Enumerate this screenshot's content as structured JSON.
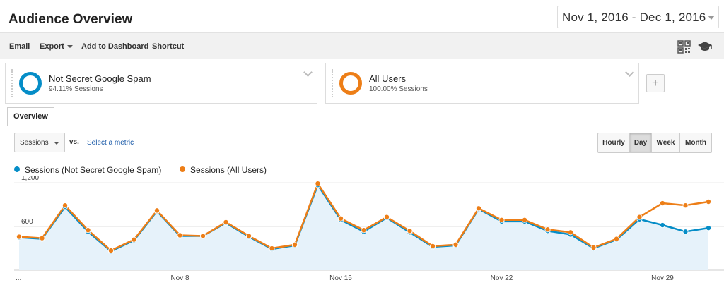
{
  "header": {
    "title": "Audience Overview",
    "date_range": "Nov 1, 2016 - Dec 1, 2016"
  },
  "toolbar": {
    "email": "Email",
    "export": "Export",
    "add_to_dashboard": "Add to Dashboard",
    "shortcut": "Shortcut"
  },
  "segments": [
    {
      "name": "Not Secret Google Spam",
      "sessions_pct": "94.11% Sessions",
      "color": "#058dc7"
    },
    {
      "name": "All Users",
      "sessions_pct": "100.00% Sessions",
      "color": "#ed7e17"
    }
  ],
  "tabs": {
    "overview": "Overview"
  },
  "controls": {
    "metric": "Sessions",
    "vs": "vs.",
    "select_metric": "Select a metric",
    "granularity": [
      "Hourly",
      "Day",
      "Week",
      "Month"
    ],
    "active_granularity": "Day"
  },
  "legend": [
    {
      "label": "Sessions (Not Secret Google Spam)",
      "color": "#058dc7"
    },
    {
      "label": "Sessions (All Users)",
      "color": "#ed7e17"
    }
  ],
  "chart_data": {
    "type": "line",
    "x_start": "...",
    "x": [
      "Nov 1",
      "Nov 2",
      "Nov 3",
      "Nov 4",
      "Nov 5",
      "Nov 6",
      "Nov 7",
      "Nov 8",
      "Nov 9",
      "Nov 10",
      "Nov 11",
      "Nov 12",
      "Nov 13",
      "Nov 14",
      "Nov 15",
      "Nov 16",
      "Nov 17",
      "Nov 18",
      "Nov 19",
      "Nov 20",
      "Nov 21",
      "Nov 22",
      "Nov 23",
      "Nov 24",
      "Nov 25",
      "Nov 26",
      "Nov 27",
      "Nov 28",
      "Nov 29",
      "Nov 30",
      "Dec 1"
    ],
    "x_tick_labels": [
      {
        "index": 7,
        "label": "Nov 8"
      },
      {
        "index": 14,
        "label": "Nov 15"
      },
      {
        "index": 21,
        "label": "Nov 22"
      },
      {
        "index": 28,
        "label": "Nov 29"
      }
    ],
    "y_ticks": [
      600,
      1200
    ],
    "y_tick_labels": [
      "600",
      "1,200"
    ],
    "ylim": [
      0,
      1250
    ],
    "series": [
      {
        "name": "Sessions (Not Secret Google Spam)",
        "color": "#058dc7",
        "area": true,
        "values": [
          450,
          430,
          870,
          530,
          260,
          410,
          810,
          470,
          470,
          650,
          460,
          290,
          340,
          1170,
          690,
          530,
          720,
          520,
          320,
          340,
          840,
          670,
          670,
          540,
          490,
          300,
          420,
          700,
          620,
          530,
          580
        ]
      },
      {
        "name": "Sessions (All Users)",
        "color": "#ed7e17",
        "area": false,
        "values": [
          460,
          440,
          890,
          550,
          270,
          420,
          820,
          480,
          470,
          660,
          470,
          300,
          350,
          1190,
          710,
          550,
          730,
          540,
          330,
          350,
          850,
          690,
          690,
          560,
          520,
          310,
          430,
          730,
          920,
          890,
          940
        ]
      }
    ],
    "grid": true,
    "legend_position": "top-left"
  }
}
